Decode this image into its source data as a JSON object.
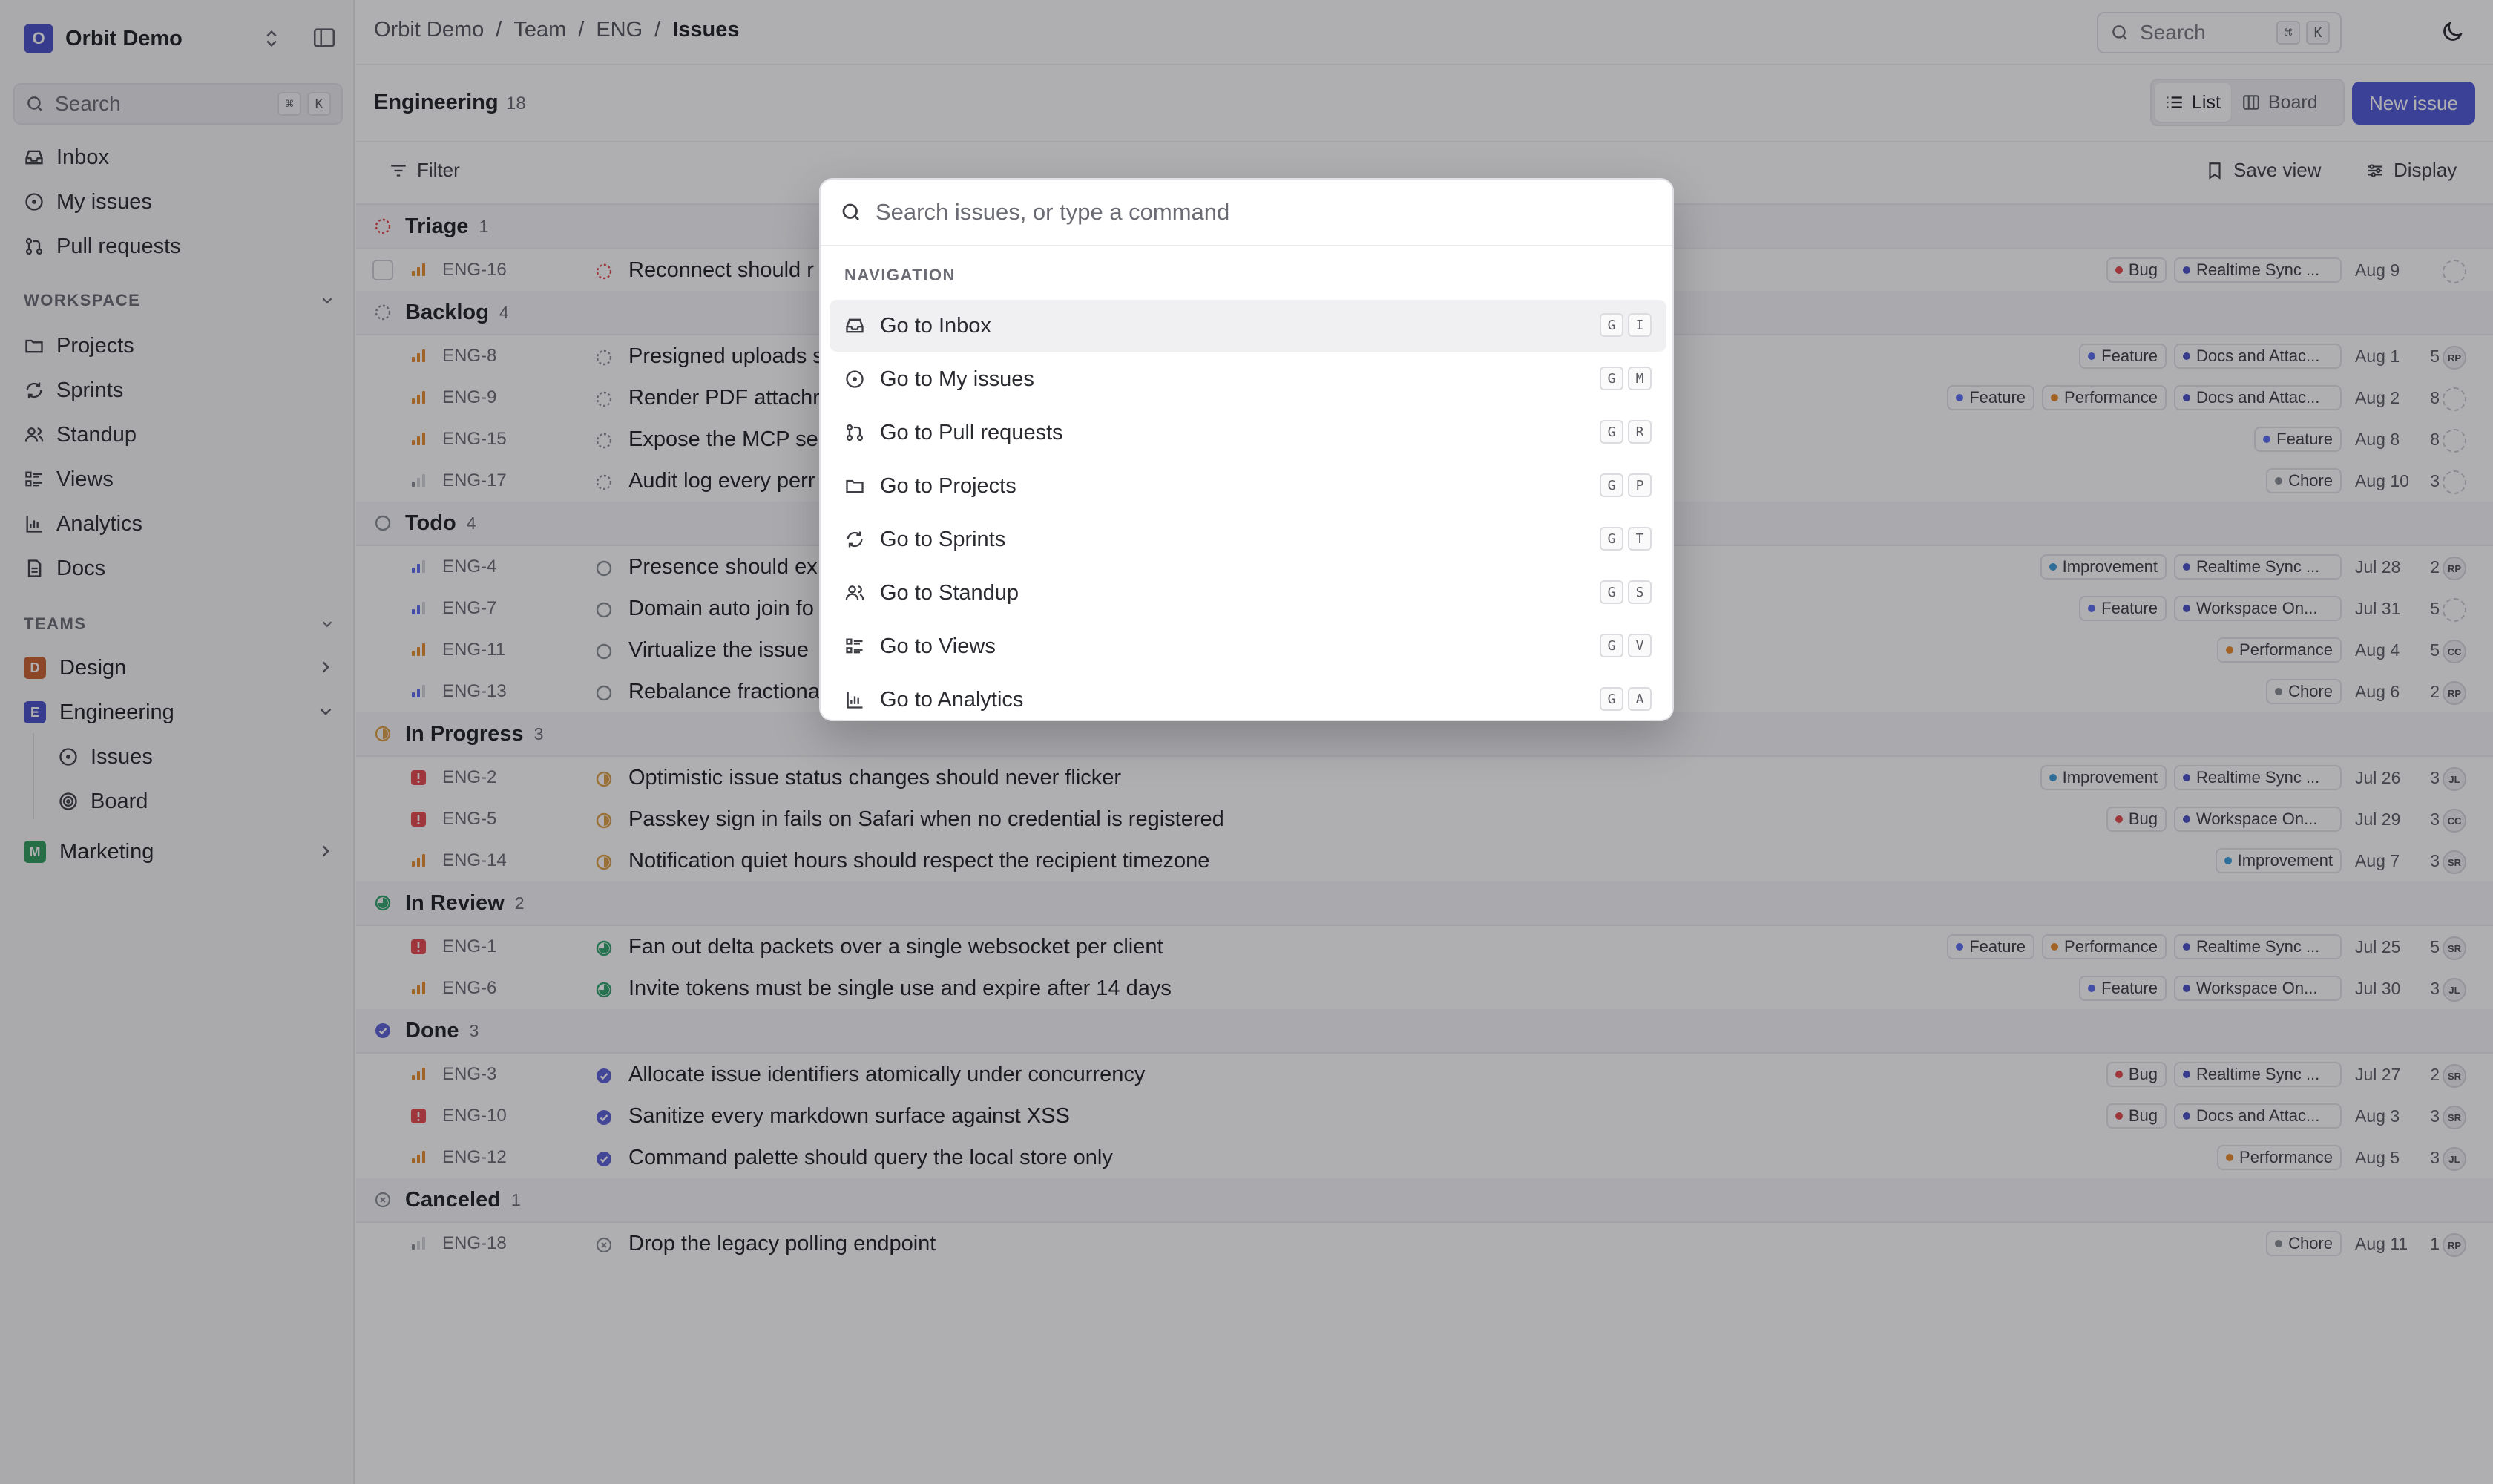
{
  "workspace": {
    "logo": "O",
    "name": "Orbit Demo"
  },
  "sidebar_search": {
    "label": "Search",
    "keys": [
      "⌘",
      "K"
    ]
  },
  "nav": [
    {
      "label": "Inbox",
      "icon": "inbox-icon"
    },
    {
      "label": "My issues",
      "icon": "circle-dot-icon"
    },
    {
      "label": "Pull requests",
      "icon": "pull-request-icon"
    }
  ],
  "workspace_section": {
    "title": "WORKSPACE",
    "items": [
      {
        "label": "Projects",
        "icon": "folder-icon"
      },
      {
        "label": "Sprints",
        "icon": "cycle-icon"
      },
      {
        "label": "Standup",
        "icon": "users-icon"
      },
      {
        "label": "Views",
        "icon": "list-icon"
      },
      {
        "label": "Analytics",
        "icon": "bar-chart-icon"
      },
      {
        "label": "Docs",
        "icon": "document-icon"
      }
    ]
  },
  "teams_section": {
    "title": "TEAMS",
    "teams": [
      {
        "logo": "D",
        "name": "Design",
        "color": "#c8622c"
      },
      {
        "logo": "E",
        "name": "Engineering",
        "color": "#4850c9"
      },
      {
        "logo": "M",
        "name": "Marketing",
        "color": "#2f9e5b"
      }
    ],
    "engineering_sub": [
      {
        "label": "Issues",
        "icon": "circle-dot-icon"
      },
      {
        "label": "Board",
        "icon": "target-icon"
      }
    ]
  },
  "breadcrumb": [
    "Orbit Demo",
    "Team",
    "ENG",
    "Issues"
  ],
  "top_search": {
    "label": "Search",
    "keys": [
      "⌘",
      "K"
    ]
  },
  "header": {
    "team": "Engineering",
    "count": "18",
    "list_label": "List",
    "board_label": "Board",
    "new_issue_label": "New issue"
  },
  "toolbar": {
    "filter_label": "Filter",
    "save_view_label": "Save view",
    "display_label": "Display"
  },
  "colors": {
    "accent": "#5058d6",
    "bug": "#e5484d",
    "feature": "#5b6cf0",
    "performance": "#e88b2a",
    "improvement": "#3b9bd8",
    "chore": "#8b8d94",
    "in_progress": "#e0a047",
    "in_review": "#30a46c",
    "done": "#5b5fd6"
  },
  "groups": [
    {
      "name": "Triage",
      "count": "1",
      "status": "triage",
      "rows": [
        {
          "id": "ENG-16",
          "prio": "high",
          "title": "Reconnect should r",
          "labels": [
            [
              "Bug",
              "bug"
            ]
          ],
          "project": "Realtime Sync ...",
          "date": "Aug 9",
          "est": "",
          "avatar": ""
        }
      ]
    },
    {
      "name": "Backlog",
      "count": "4",
      "status": "backlog",
      "rows": [
        {
          "id": "ENG-8",
          "prio": "high",
          "title": "Presigned uploads s",
          "labels": [
            [
              "Feature",
              "feature"
            ]
          ],
          "project": "Docs and Attac...",
          "date": "Aug 1",
          "est": "5",
          "avatar": "RP"
        },
        {
          "id": "ENG-9",
          "prio": "high",
          "title": "Render PDF attachr",
          "labels": [
            [
              "Feature",
              "feature"
            ],
            [
              "Performance",
              "performance"
            ]
          ],
          "project": "Docs and Attac...",
          "date": "Aug 2",
          "est": "8",
          "avatar": ""
        },
        {
          "id": "ENG-15",
          "prio": "high",
          "title": "Expose the MCP se",
          "labels": [
            [
              "Feature",
              "feature"
            ]
          ],
          "project": "",
          "date": "Aug 8",
          "est": "8",
          "avatar": ""
        },
        {
          "id": "ENG-17",
          "prio": "low",
          "title": "Audit log every perr",
          "labels": [
            [
              "Chore",
              "chore"
            ]
          ],
          "project": "",
          "date": "Aug 10",
          "est": "3",
          "avatar": ""
        }
      ]
    },
    {
      "name": "Todo",
      "count": "4",
      "status": "todo",
      "rows": [
        {
          "id": "ENG-4",
          "prio": "medium",
          "title": "Presence should ex",
          "labels": [
            [
              "Improvement",
              "improvement"
            ]
          ],
          "project": "Realtime Sync ...",
          "date": "Jul 28",
          "est": "2",
          "avatar": "RP"
        },
        {
          "id": "ENG-7",
          "prio": "medium",
          "title": "Domain auto join fo",
          "labels": [
            [
              "Feature",
              "feature"
            ]
          ],
          "project": "Workspace On...",
          "date": "Jul 31",
          "est": "5",
          "avatar": ""
        },
        {
          "id": "ENG-11",
          "prio": "high",
          "title": "Virtualize the issue",
          "labels": [
            [
              "Performance",
              "performance"
            ]
          ],
          "project": "",
          "date": "Aug 4",
          "est": "5",
          "avatar": "CC"
        },
        {
          "id": "ENG-13",
          "prio": "medium",
          "title": "Rebalance fractiona",
          "labels": [
            [
              "Chore",
              "chore"
            ]
          ],
          "project": "",
          "date": "Aug 6",
          "est": "2",
          "avatar": "RP"
        }
      ]
    },
    {
      "name": "In Progress",
      "count": "3",
      "status": "in_progress",
      "rows": [
        {
          "id": "ENG-2",
          "prio": "urgent",
          "title": "Optimistic issue status changes should never flicker",
          "labels": [
            [
              "Improvement",
              "improvement"
            ]
          ],
          "project": "Realtime Sync ...",
          "date": "Jul 26",
          "est": "3",
          "avatar": "JL"
        },
        {
          "id": "ENG-5",
          "prio": "urgent",
          "title": "Passkey sign in fails on Safari when no credential is registered",
          "labels": [
            [
              "Bug",
              "bug"
            ]
          ],
          "project": "Workspace On...",
          "date": "Jul 29",
          "est": "3",
          "avatar": "CC"
        },
        {
          "id": "ENG-14",
          "prio": "high",
          "title": "Notification quiet hours should respect the recipient timezone",
          "labels": [
            [
              "Improvement",
              "improvement"
            ]
          ],
          "project": "",
          "date": "Aug 7",
          "est": "3",
          "avatar": "SR"
        }
      ]
    },
    {
      "name": "In Review",
      "count": "2",
      "status": "in_review",
      "rows": [
        {
          "id": "ENG-1",
          "prio": "urgent",
          "title": "Fan out delta packets over a single websocket per client",
          "labels": [
            [
              "Feature",
              "feature"
            ],
            [
              "Performance",
              "performance"
            ]
          ],
          "project": "Realtime Sync ...",
          "date": "Jul 25",
          "est": "5",
          "avatar": "SR"
        },
        {
          "id": "ENG-6",
          "prio": "high",
          "title": "Invite tokens must be single use and expire after 14 days",
          "labels": [
            [
              "Feature",
              "feature"
            ]
          ],
          "project": "Workspace On...",
          "date": "Jul 30",
          "est": "3",
          "avatar": "JL"
        }
      ]
    },
    {
      "name": "Done",
      "count": "3",
      "status": "done",
      "rows": [
        {
          "id": "ENG-3",
          "prio": "high",
          "title": "Allocate issue identifiers atomically under concurrency",
          "labels": [
            [
              "Bug",
              "bug"
            ]
          ],
          "project": "Realtime Sync ...",
          "date": "Jul 27",
          "est": "2",
          "avatar": "SR"
        },
        {
          "id": "ENG-10",
          "prio": "urgent",
          "title": "Sanitize every markdown surface against XSS",
          "labels": [
            [
              "Bug",
              "bug"
            ]
          ],
          "project": "Docs and Attac...",
          "date": "Aug 3",
          "est": "3",
          "avatar": "SR"
        },
        {
          "id": "ENG-12",
          "prio": "high",
          "title": "Command palette should query the local store only",
          "labels": [
            [
              "Performance",
              "performance"
            ]
          ],
          "project": "",
          "date": "Aug 5",
          "est": "3",
          "avatar": "JL"
        }
      ]
    },
    {
      "name": "Canceled",
      "count": "1",
      "status": "canceled",
      "rows": [
        {
          "id": "ENG-18",
          "prio": "low",
          "title": "Drop the legacy polling endpoint",
          "labels": [
            [
              "Chore",
              "chore"
            ]
          ],
          "project": "",
          "date": "Aug 11",
          "est": "1",
          "avatar": "RP"
        }
      ]
    }
  ],
  "palette": {
    "placeholder": "Search issues, or type a command",
    "section": "NAVIGATION",
    "items": [
      {
        "label": "Go to Inbox",
        "icon": "inbox-icon",
        "keys": [
          "G",
          "I"
        ]
      },
      {
        "label": "Go to My issues",
        "icon": "circle-dot-icon",
        "keys": [
          "G",
          "M"
        ]
      },
      {
        "label": "Go to Pull requests",
        "icon": "pull-request-icon",
        "keys": [
          "G",
          "R"
        ]
      },
      {
        "label": "Go to Projects",
        "icon": "folder-icon",
        "keys": [
          "G",
          "P"
        ]
      },
      {
        "label": "Go to Sprints",
        "icon": "cycle-icon",
        "keys": [
          "G",
          "T"
        ]
      },
      {
        "label": "Go to Standup",
        "icon": "users-icon",
        "keys": [
          "G",
          "S"
        ]
      },
      {
        "label": "Go to Views",
        "icon": "list-icon",
        "keys": [
          "G",
          "V"
        ]
      },
      {
        "label": "Go to Analytics",
        "icon": "bar-chart-icon",
        "keys": [
          "G",
          "A"
        ]
      }
    ]
  }
}
